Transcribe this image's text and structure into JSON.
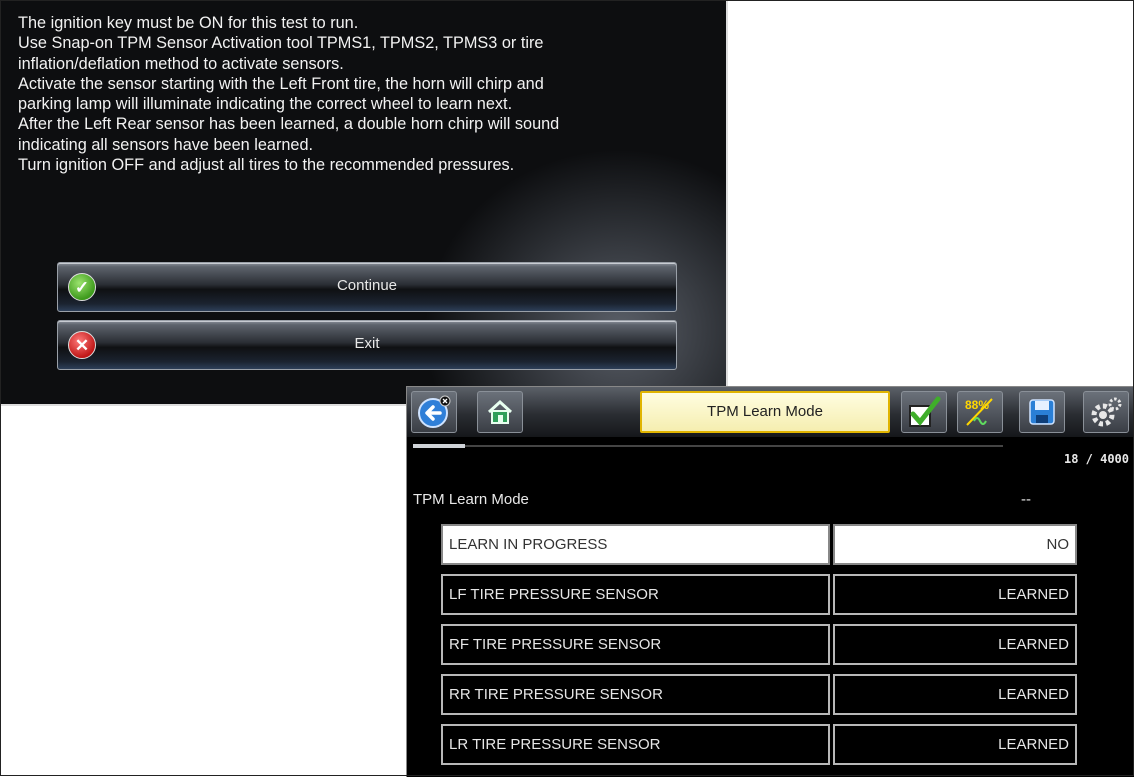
{
  "screen1": {
    "instruction_lines": [
      "The ignition key must be ON for this test to run.",
      "Use Snap-on TPM Sensor Activation tool TPMS1, TPMS2, TPMS3 or tire",
      "inflation/deflation method to activate sensors.",
      "Activate the sensor starting with the Left Front tire, the horn will chirp and",
      "parking lamp will illuminate indicating the correct wheel to learn next.",
      "After the Left Rear sensor has been learned, a double horn chirp will sound",
      "indicating all sensors have been learned.",
      "Turn ignition OFF and adjust all tires to the recommended pressures."
    ],
    "continue_label": "Continue",
    "exit_label": "Exit"
  },
  "screen2": {
    "toolbar": {
      "title": "TPM Learn Mode",
      "icons": [
        "back-icon",
        "home-icon",
        "checkmark-icon",
        "scale-percent-icon",
        "save-icon",
        "settings-gear-icon"
      ],
      "scale_icon_text": "88%"
    },
    "record_progress": 0.004,
    "record_count": "18 / 4000",
    "parameter": {
      "name": "TPM Learn Mode",
      "value": "--"
    },
    "rows": [
      {
        "name": "LEARN IN PROGRESS",
        "value": "NO",
        "selected": true
      },
      {
        "name": "LF TIRE PRESSURE SENSOR",
        "value": "LEARNED"
      },
      {
        "name": "RF TIRE PRESSURE SENSOR",
        "value": "LEARNED"
      },
      {
        "name": "RR TIRE PRESSURE SENSOR",
        "value": "LEARNED"
      },
      {
        "name": "LR TIRE PRESSURE SENSOR",
        "value": "LEARNED"
      }
    ],
    "colors": {
      "title_highlight": "#f5eeb0",
      "title_border": "#e0b400"
    }
  }
}
